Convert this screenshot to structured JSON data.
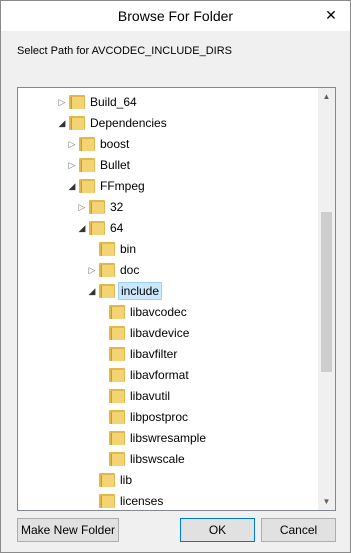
{
  "window": {
    "title": "Browse For Folder"
  },
  "prompt": "Select Path for AVCODEC_INCLUDE_DIRS",
  "icons": {
    "close": "close-icon",
    "folder": "folder-icon",
    "expanded": "expanded-arrow-icon",
    "collapsed": "collapsed-arrow-icon"
  },
  "tree": {
    "items": [
      {
        "label": "Build_64",
        "level": 0,
        "state": "collapsed"
      },
      {
        "label": "Dependencies",
        "level": 0,
        "state": "expanded"
      },
      {
        "label": "boost",
        "level": 1,
        "state": "collapsed"
      },
      {
        "label": "Bullet",
        "level": 1,
        "state": "collapsed"
      },
      {
        "label": "FFmpeg",
        "level": 1,
        "state": "expanded"
      },
      {
        "label": "32",
        "level": 2,
        "state": "collapsed"
      },
      {
        "label": "64",
        "level": 2,
        "state": "expanded"
      },
      {
        "label": "bin",
        "level": 3,
        "state": "none"
      },
      {
        "label": "doc",
        "level": 3,
        "state": "collapsed"
      },
      {
        "label": "include",
        "level": 3,
        "state": "expanded",
        "selected": true
      },
      {
        "label": "libavcodec",
        "level": 4,
        "state": "none"
      },
      {
        "label": "libavdevice",
        "level": 4,
        "state": "none"
      },
      {
        "label": "libavfilter",
        "level": 4,
        "state": "none"
      },
      {
        "label": "libavformat",
        "level": 4,
        "state": "none"
      },
      {
        "label": "libavutil",
        "level": 4,
        "state": "none"
      },
      {
        "label": "libpostproc",
        "level": 4,
        "state": "none"
      },
      {
        "label": "libswresample",
        "level": 4,
        "state": "none"
      },
      {
        "label": "libswscale",
        "level": 4,
        "state": "none"
      },
      {
        "label": "lib",
        "level": 3,
        "state": "none"
      },
      {
        "label": "licenses",
        "level": 3,
        "state": "none"
      }
    ]
  },
  "buttons": {
    "make_new_folder": "Make New Folder",
    "ok": "OK",
    "cancel": "Cancel"
  },
  "colors": {
    "selection_bg": "#cce8ff",
    "selection_border": "#99d1ff",
    "folder": "#f4d372"
  }
}
